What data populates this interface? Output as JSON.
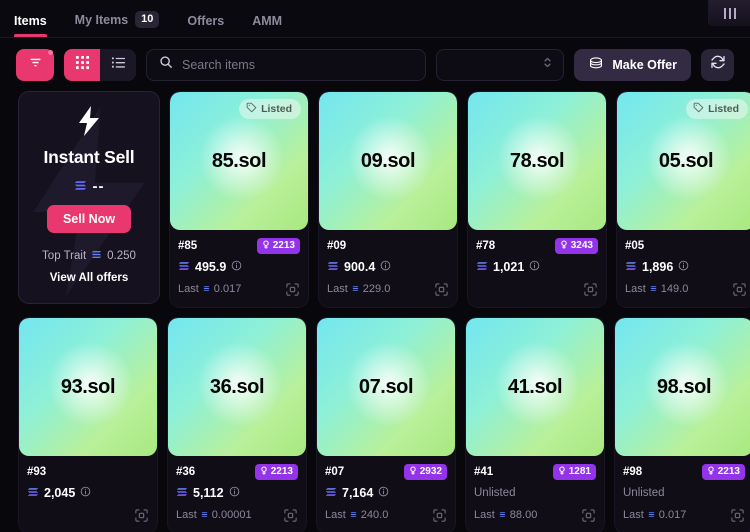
{
  "tabs": [
    {
      "label": "Items",
      "count": null,
      "active": true,
      "name": "tab-items"
    },
    {
      "label": "My Items",
      "count": "10",
      "active": false,
      "name": "tab-my-items"
    },
    {
      "label": "Offers",
      "count": null,
      "active": false,
      "name": "tab-offers"
    },
    {
      "label": "AMM",
      "count": null,
      "active": false,
      "name": "tab-amm"
    }
  ],
  "toolbar": {
    "filter_icon": "filter-icon",
    "grid_view_icon": "grid-view-icon",
    "list_view_icon": "list-view-icon",
    "search_placeholder": "Search items",
    "search_value": "",
    "search_icon": "search-icon",
    "select_value": "",
    "select_icon": "chevron-up-down-icon",
    "make_offer_label": "Make Offer",
    "make_offer_icon": "coins-icon",
    "refresh_icon": "refresh-icon"
  },
  "instant_sell": {
    "bolt_icon": "lightning-bolt-icon",
    "title": "Instant Sell",
    "price": "--",
    "price_icon": "sol-icon",
    "sell_button": "Sell Now",
    "top_trait_label": "Top Trait",
    "top_trait_value": "0.250",
    "top_trait_icon": "sol-icon",
    "view_all_label": "View All offers"
  },
  "colors": {
    "accent_pink": "#e8386f",
    "rank_purple": "#9333ea",
    "background": "#08070b",
    "card_bg": "#100d17",
    "listed_badge": "#ecf6f0"
  },
  "items": [
    {
      "name": "85.sol",
      "id": "#85",
      "listed": true,
      "listed_label": "Listed",
      "rank": "2213",
      "price": "495.9",
      "last_label": "Last",
      "last": "0.017",
      "unlisted_label": null
    },
    {
      "name": "09.sol",
      "id": "#09",
      "listed": false,
      "listed_label": "Listed",
      "rank": null,
      "price": "900.4",
      "last_label": "Last",
      "last": "229.0",
      "unlisted_label": null
    },
    {
      "name": "78.sol",
      "id": "#78",
      "listed": false,
      "listed_label": "Listed",
      "rank": "3243",
      "price": "1,021",
      "last_label": "Last",
      "last": null,
      "unlisted_label": null
    },
    {
      "name": "05.sol",
      "id": "#05",
      "listed": true,
      "listed_label": "Listed",
      "rank": null,
      "price": "1,896",
      "last_label": "Last",
      "last": "149.0",
      "unlisted_label": null
    },
    {
      "name": "93.sol",
      "id": "#93",
      "listed": false,
      "listed_label": "Listed",
      "rank": null,
      "price": "2,045",
      "last_label": "Last",
      "last": null,
      "unlisted_label": null
    },
    {
      "name": "36.sol",
      "id": "#36",
      "listed": false,
      "listed_label": "Listed",
      "rank": "2213",
      "price": "5,112",
      "last_label": "Last",
      "last": "0.00001",
      "unlisted_label": null
    },
    {
      "name": "07.sol",
      "id": "#07",
      "listed": false,
      "listed_label": "Listed",
      "rank": "2932",
      "price": "7,164",
      "last_label": "Last",
      "last": "240.0",
      "unlisted_label": null
    },
    {
      "name": "41.sol",
      "id": "#41",
      "listed": false,
      "listed_label": "Listed",
      "rank": "1281",
      "price": null,
      "last_label": "Last",
      "last": "88.00",
      "unlisted_label": "Unlisted"
    },
    {
      "name": "98.sol",
      "id": "#98",
      "listed": false,
      "listed_label": "Listed",
      "rank": "2213",
      "price": null,
      "last_label": "Last",
      "last": "0.017",
      "unlisted_label": "Unlisted"
    }
  ]
}
